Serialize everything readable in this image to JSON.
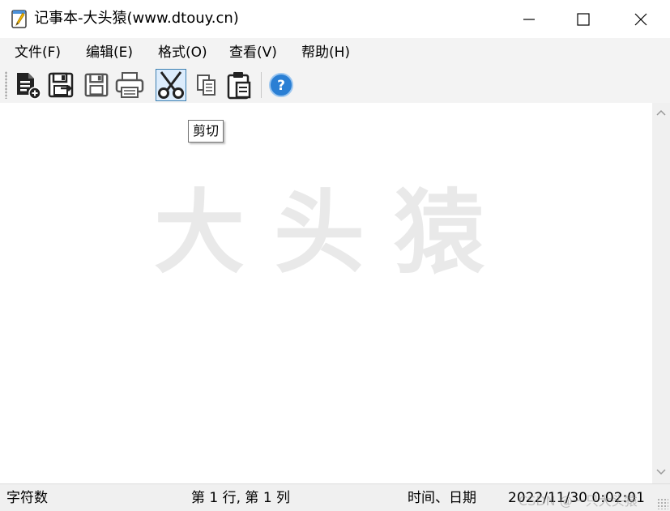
{
  "window": {
    "title": "记事本-大头猿(www.dtouy.cn)"
  },
  "menu": {
    "items": [
      {
        "label": "文件(F)"
      },
      {
        "label": "编辑(E)"
      },
      {
        "label": "格式(O)"
      },
      {
        "label": "查看(V)"
      },
      {
        "label": "帮助(H)"
      }
    ]
  },
  "toolbar": {
    "icons": [
      "new-file-icon",
      "save-as-icon",
      "save-icon",
      "print-icon",
      "cut-icon",
      "copy-icon",
      "paste-icon",
      "help-icon"
    ],
    "active": "cut-icon",
    "tooltip": "剪切"
  },
  "editor": {
    "watermark": "大头猿"
  },
  "status": {
    "char_count": "字符数",
    "position": "第 1 行, 第 1 列",
    "datetime_label": "时间、日期",
    "datetime_value": "2022/11/30 0:02:01"
  },
  "overlay": {
    "csdn": "CSDN @一只大头猿"
  },
  "colors": {
    "accent": "#3c7fb1",
    "help_blue": "#2a7fd4",
    "watermark": "#e9e9e9"
  }
}
